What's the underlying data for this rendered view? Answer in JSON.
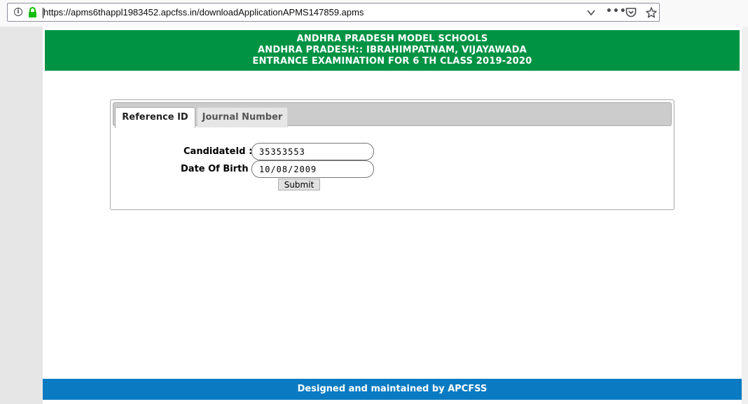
{
  "browser": {
    "url": "https://apms6thappl1983452.apcfss.in/downloadApplicationAPMS147859.apms",
    "icons": [
      "info-icon",
      "lock-icon",
      "chevron-down-icon",
      "more-icon",
      "pocket-icon",
      "star-icon"
    ],
    "info_glyph": "i",
    "more_glyph": "•••"
  },
  "header": {
    "line1": "ANDHRA PRADESH MODEL SCHOOLS",
    "line2": "ANDHRA PRADESH:: IBRAHIMPATNAM, VIJAYAWADA",
    "line3": "ENTRANCE EXAMINATION FOR 6 TH CLASS 2019-2020",
    "color": "#009344"
  },
  "tabs": [
    {
      "label": "Reference ID",
      "active": true
    },
    {
      "label": "Journal Number",
      "active": false
    }
  ],
  "form": {
    "candidate_label": "CandidateId :",
    "candidate_value": "35353553",
    "dob_label": "Date Of Birth :",
    "dob_value": "10/08/2009",
    "submit_label": "Submit"
  },
  "footer": {
    "text": "Designed and maintained by APCFSS",
    "color": "#0a7bc2"
  }
}
